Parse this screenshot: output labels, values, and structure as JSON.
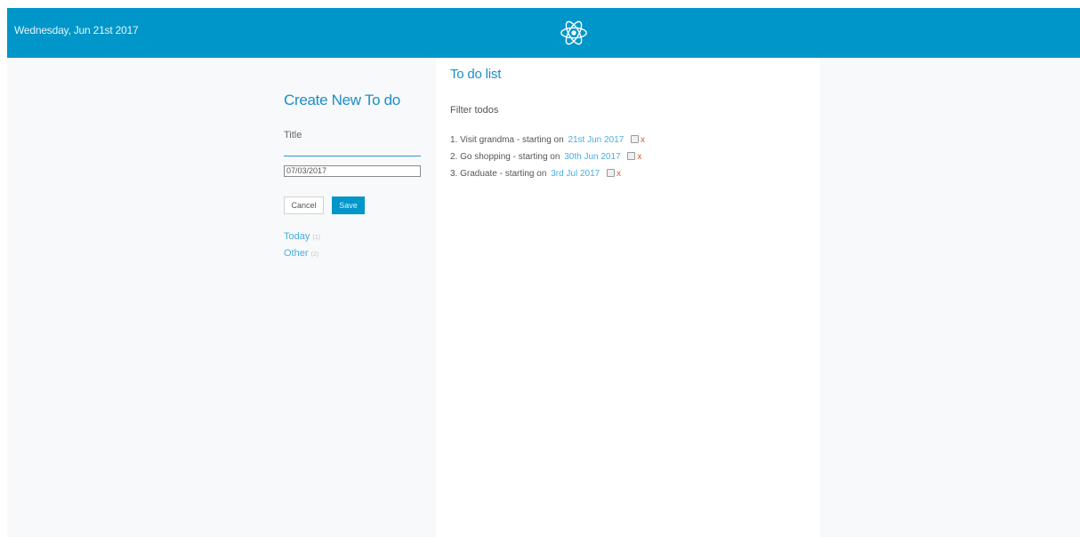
{
  "header": {
    "date": "Wednesday, Jun 21st 2017",
    "logo_icon": "react-atom-icon",
    "color": "#0096c9"
  },
  "create_form": {
    "heading": "Create New To do",
    "title_label": "Title",
    "title_value": "",
    "date_value": "07/03/2017",
    "cancel_label": "Cancel",
    "save_label": "Save"
  },
  "filters": [
    {
      "label": "Today",
      "count": "(1)"
    },
    {
      "label": "Other",
      "count": "(2)"
    }
  ],
  "todo_list": {
    "heading": "To do list",
    "filter_placeholder": "Filter todos",
    "items": [
      {
        "text": "1. Visit grandma -  starting on",
        "date": "21st Jun 2017",
        "delete": "x"
      },
      {
        "text": "2. Go shopping -  starting on",
        "date": "30th Jun 2017",
        "delete": "x"
      },
      {
        "text": "3. Graduate -  starting on",
        "date": "3rd Jul 2017",
        "delete": "x"
      }
    ]
  }
}
